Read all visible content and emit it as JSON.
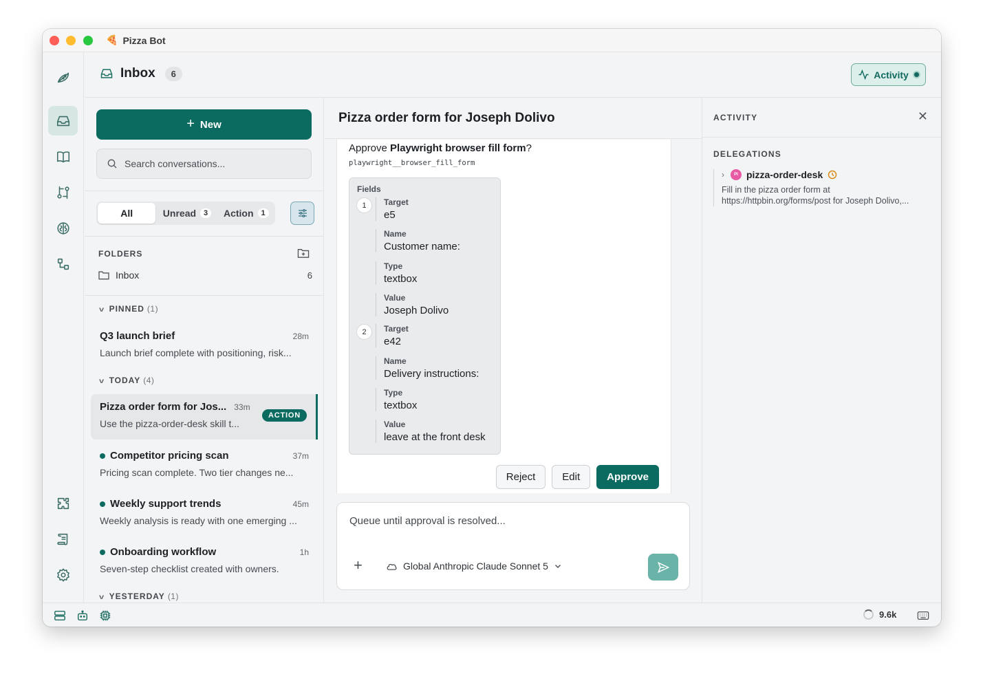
{
  "window": {
    "title": "Pizza Bot",
    "app_icon": "pizza-icon"
  },
  "rail": {
    "items": [
      {
        "icon": "logo-icon"
      },
      {
        "icon": "inbox-icon",
        "active": true
      },
      {
        "icon": "book-icon"
      },
      {
        "icon": "workflow-icon"
      },
      {
        "icon": "brain-icon"
      },
      {
        "icon": "connections-icon"
      },
      {
        "icon": "puzzle-icon"
      },
      {
        "icon": "scroll-icon"
      },
      {
        "icon": "gear-icon"
      }
    ]
  },
  "header": {
    "title": "Inbox",
    "count": "6",
    "activity_label": "Activity"
  },
  "list": {
    "new_label": "New",
    "search_placeholder": "Search conversations...",
    "filters": [
      {
        "label": "All",
        "count": ""
      },
      {
        "label": "Unread",
        "count": "3"
      },
      {
        "label": "Action",
        "count": "1"
      }
    ],
    "folders_label": "FOLDERS",
    "folder": {
      "name": "Inbox",
      "count": "6"
    },
    "pinned": {
      "label": "PINNED",
      "count": "(1)"
    },
    "today": {
      "label": "TODAY",
      "count": "(4)"
    },
    "yesterday": {
      "label": "YESTERDAY",
      "count": "(1)"
    },
    "conversations": [
      {
        "title": "Q3 launch brief",
        "time": "28m",
        "preview": "Launch brief complete with positioning, risk..."
      },
      {
        "title": "Pizza order form for Jos...",
        "time": "33m",
        "preview": "Use the pizza-order-desk skill t...",
        "badge": "ACTION"
      },
      {
        "title": "Competitor pricing scan",
        "time": "37m",
        "preview": "Pricing scan complete. Two tier changes ne..."
      },
      {
        "title": "Weekly support trends",
        "time": "45m",
        "preview": "Weekly analysis is ready with one emerging ..."
      },
      {
        "title": "Onboarding workflow",
        "time": "1h",
        "preview": "Seven-step checklist created with owners."
      }
    ]
  },
  "main": {
    "title": "Pizza order form for Joseph Dolivo",
    "approve_prefix": "Approve ",
    "approve_tool": "Playwright browser fill form",
    "approve_suffix": "?",
    "tool_id": "playwright__browser_fill_form",
    "fields_label": "Fields",
    "fields": [
      {
        "num": "1",
        "target": "e5",
        "name": "Customer name:",
        "type": "textbox",
        "value": "Joseph Dolivo"
      },
      {
        "num": "2",
        "target": "e42",
        "name": "Delivery instructions:",
        "type": "textbox",
        "value": "leave at the front desk"
      }
    ],
    "keys": {
      "target": "Target",
      "name": "Name",
      "type": "Type",
      "value": "Value"
    },
    "reject_label": "Reject",
    "edit_label": "Edit",
    "approve_label": "Approve",
    "composer_placeholder": "Queue until approval is resolved...",
    "model": "Global Anthropic Claude Sonnet 5"
  },
  "activity": {
    "title": "ACTIVITY",
    "delegations_label": "DELEGATIONS",
    "delegation": {
      "avatar": "PI",
      "name": "pizza-order-desk",
      "desc_line1": "Fill in the pizza order form at",
      "desc_line2": "https://httpbin.org/forms/post for Joseph Dolivo,..."
    }
  },
  "status": {
    "tokens": "9.6k"
  },
  "colors": {
    "accent": "#0c6b60",
    "accent_light": "#dcefeb",
    "pending": "#d9870e",
    "avatar": "#e85aa3"
  }
}
